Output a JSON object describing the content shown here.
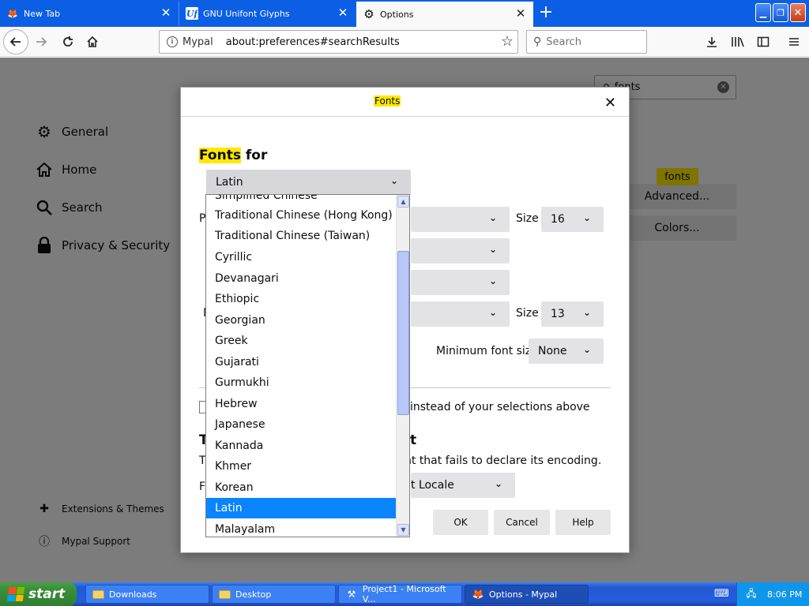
{
  "tabs": [
    {
      "title": "New Tab",
      "icon": "mypal-icon"
    },
    {
      "title": "GNU Unifont Glyphs",
      "icon": "unifont-icon",
      "icon_text": "Uf"
    },
    {
      "title": "Options",
      "icon": "gear-icon"
    }
  ],
  "nav": {
    "identity": "Mypal",
    "url": "about:preferences#searchResults",
    "search_placeholder": "Search"
  },
  "sidebar": {
    "items": [
      {
        "label": "General",
        "icon": "gear-icon"
      },
      {
        "label": "Home",
        "icon": "home-icon"
      },
      {
        "label": "Search",
        "icon": "search-icon"
      },
      {
        "label": "Privacy & Security",
        "icon": "lock-icon"
      }
    ],
    "footer": [
      {
        "label": "Extensions & Themes",
        "icon": "puzzle-icon"
      },
      {
        "label": "Mypal Support",
        "icon": "help-icon"
      }
    ]
  },
  "page": {
    "search_value": "fonts",
    "fonts_badge": "fonts",
    "advanced_label": "Advanced...",
    "colors_label": "Colors..."
  },
  "dialog": {
    "title": "Fonts",
    "fonts_for_highlight": "Fonts",
    "fonts_for_rest": " for",
    "selected_language": "Latin",
    "proportional_size_label": "Size",
    "proportional_size": "16",
    "monospace_size_label": "Size",
    "monospace_size": "13",
    "min_font_size_label": "Minimum font size",
    "min_font_size": "None",
    "allow_pages_text": "instead of your selections above",
    "encoding_heading": "t",
    "encoding_desc": "nt that fails to declare its encoding.",
    "encoding_value": "t Locale",
    "ok_label": "OK",
    "cancel_label": "Cancel",
    "help_label": "Help"
  },
  "dropdown": {
    "partial_top": "Simplified Chinese",
    "items": [
      "Traditional Chinese (Hong Kong)",
      "Traditional Chinese (Taiwan)",
      "Cyrillic",
      "Devanagari",
      "Ethiopic",
      "Georgian",
      "Greek",
      "Gujarati",
      "Gurmukhi",
      "Hebrew",
      "Japanese",
      "Kannada",
      "Khmer",
      "Korean",
      "Latin",
      "Malayalam"
    ],
    "selected": "Latin"
  },
  "taskbar": {
    "start_label": "start",
    "items": [
      {
        "label": "Downloads",
        "icon": "folder-icon"
      },
      {
        "label": "Desktop",
        "icon": "folder-icon"
      },
      {
        "label": "Project1 - Microsoft V...",
        "icon": "vb-icon"
      },
      {
        "label": "Options - Mypal",
        "icon": "mypal-icon"
      }
    ],
    "clock": "8:06 PM"
  },
  "colors": {
    "titlebar": "#0c5fe4",
    "highlight": "#ffe900",
    "selection": "#0a84ff",
    "start_green": "#3a8f3a"
  }
}
